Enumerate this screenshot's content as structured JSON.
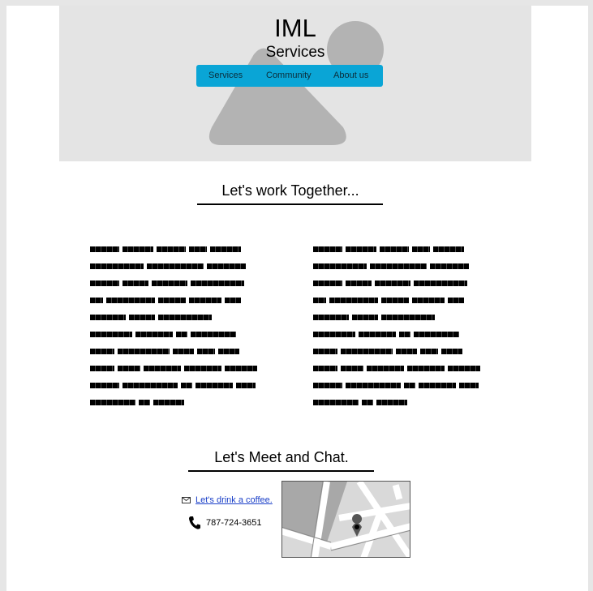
{
  "hero": {
    "title": "IML",
    "subtitle": "Services",
    "nav": [
      "Services",
      "Community",
      "About us"
    ]
  },
  "work": {
    "title": "Let's work Together..."
  },
  "meet": {
    "title": "Let's Meet and Chat.",
    "email_label": "Let's drink a coffee.",
    "phone": "787-724-3651"
  },
  "icons": {
    "email": "envelope-icon",
    "phone": "phone-icon",
    "map": "map-placeholder",
    "hero_image": "image-placeholder"
  },
  "colors": {
    "nav_bg": "#0aa5d6",
    "hero_bg": "#e4e4e4",
    "link": "#1a3fc8"
  }
}
